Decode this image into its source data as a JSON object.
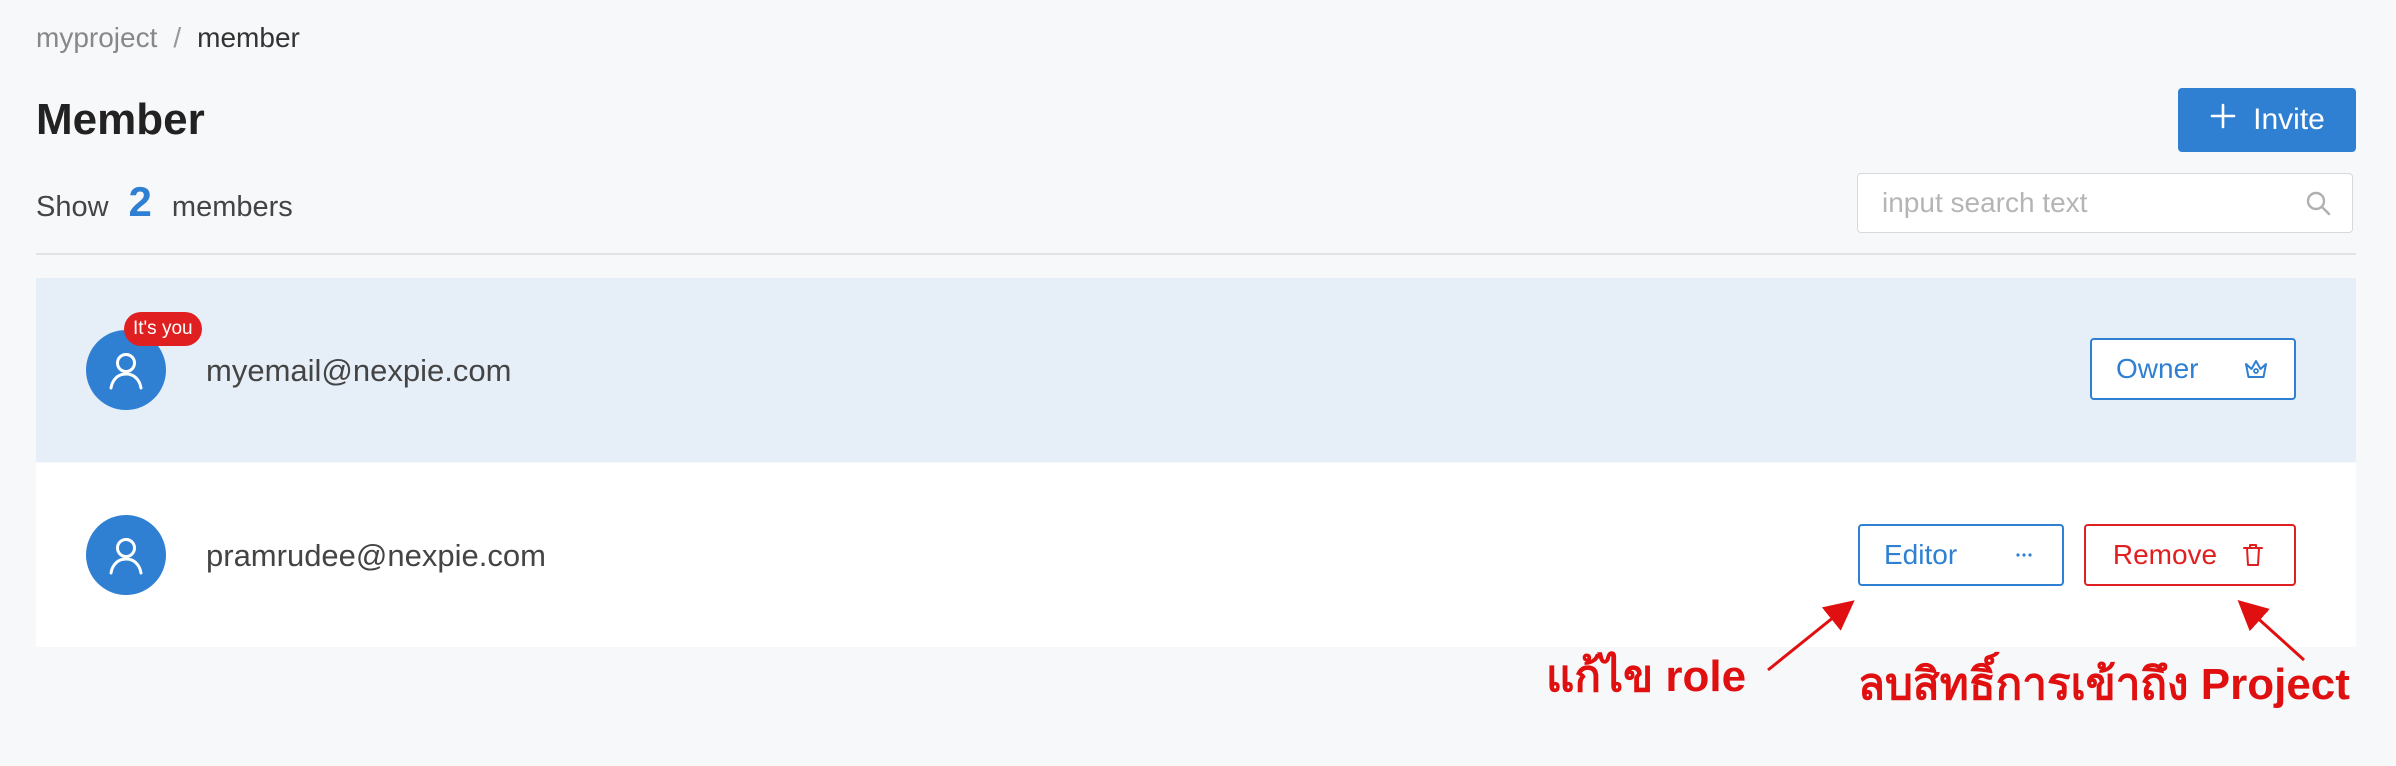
{
  "breadcrumb": {
    "project": "myproject",
    "separator": "/",
    "current": "member"
  },
  "page": {
    "title": "Member"
  },
  "invite_button": {
    "label": "Invite",
    "icon": "plus-icon"
  },
  "summary": {
    "prefix": "Show",
    "count": "2",
    "suffix": "members"
  },
  "search": {
    "placeholder": "input search text",
    "value": "",
    "icon": "search-icon"
  },
  "members": [
    {
      "email": "myemail@nexpie.com",
      "badge": "It's you",
      "role": "Owner",
      "role_icon": "crown-icon",
      "highlighted": true
    },
    {
      "email": "pramrudee@nexpie.com",
      "role": "Editor",
      "role_icon": "ellipsis-icon",
      "remove_label": "Remove",
      "remove_icon": "trash-icon"
    }
  ],
  "annotations": {
    "edit_role": "แก้ไข role",
    "remove_access": "ลบสิทธิ์การเข้าถึง Project"
  },
  "colors": {
    "primary": "#2f7fd3",
    "danger": "#e02020",
    "highlight_row": "#e6eef8",
    "annotation": "#e01010"
  }
}
